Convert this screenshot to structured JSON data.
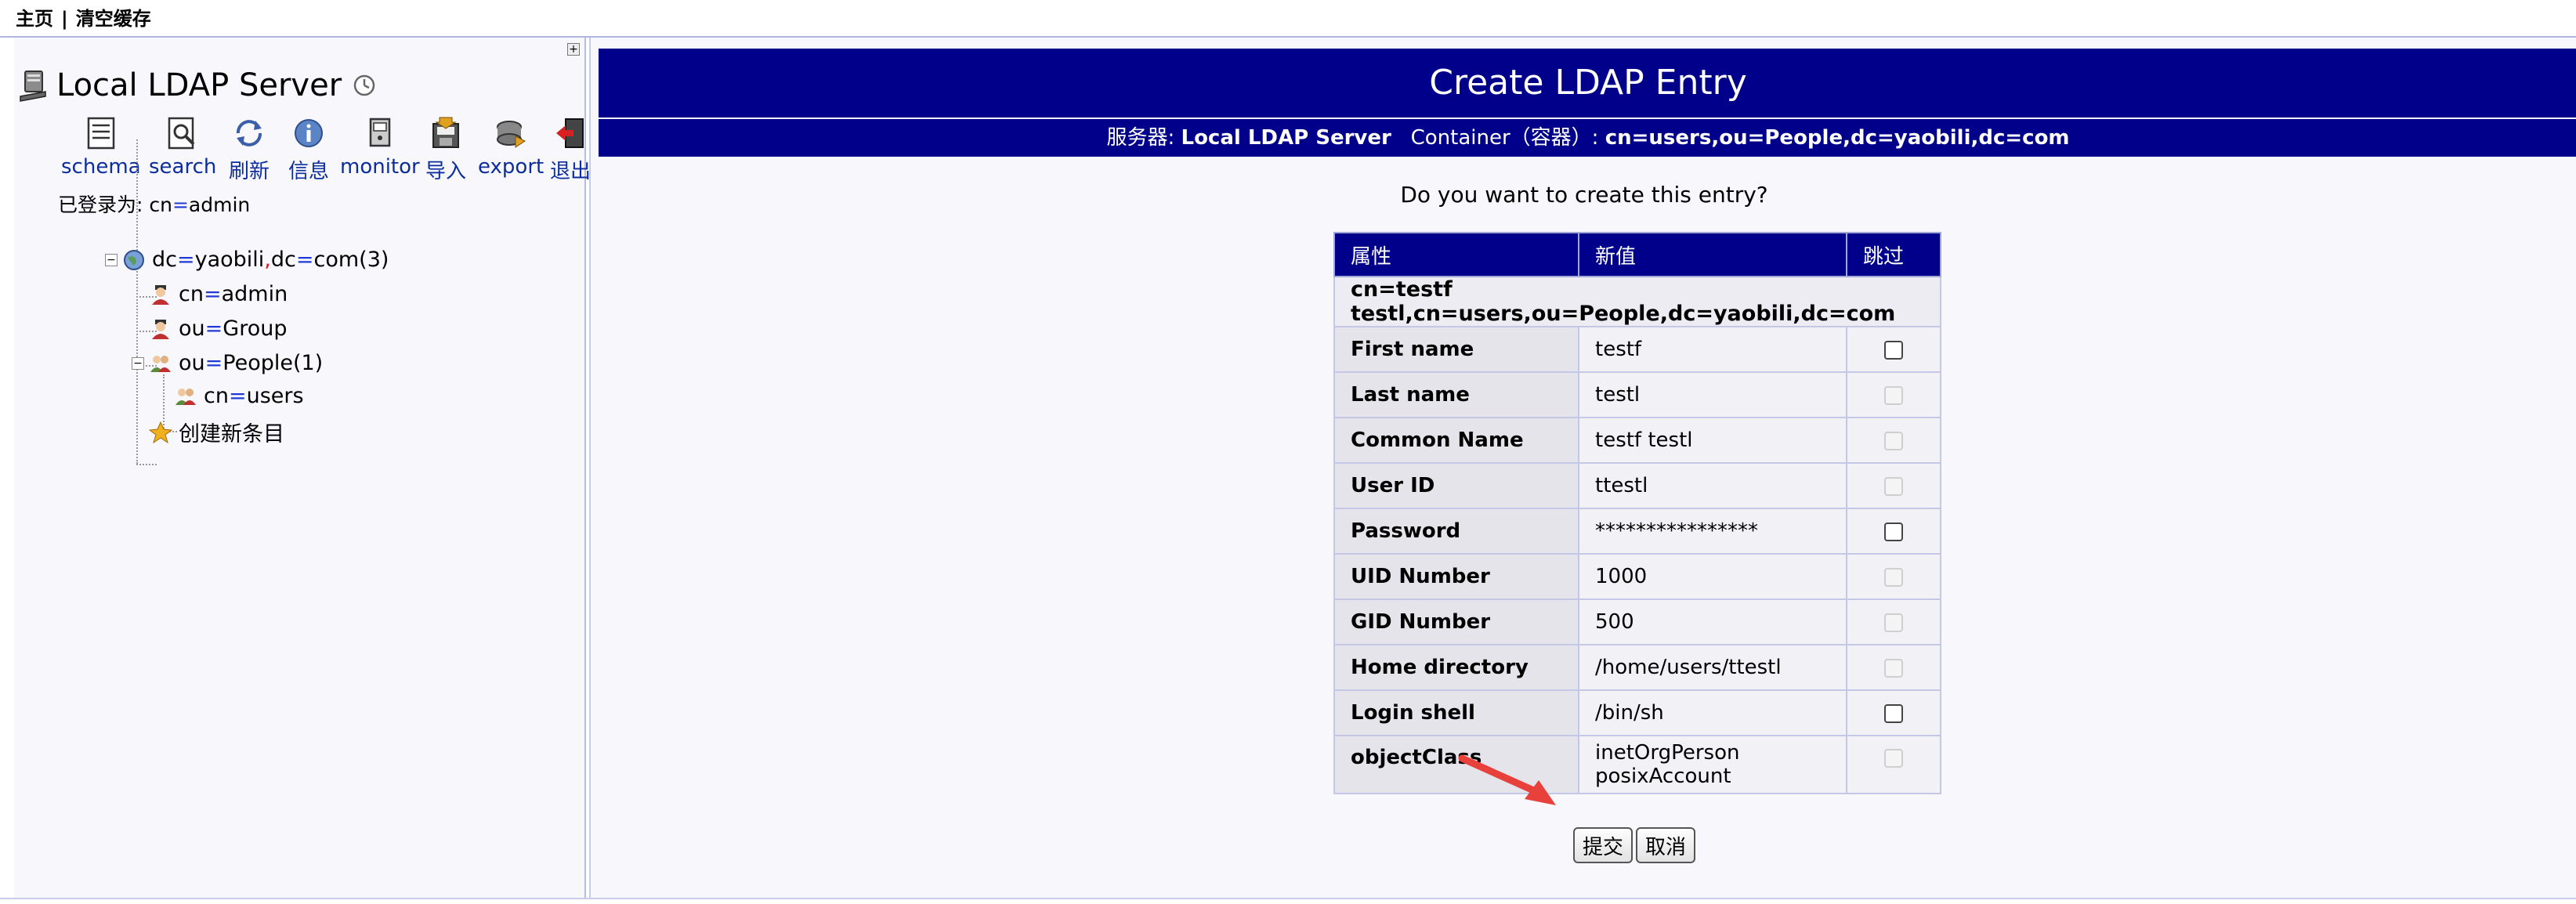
{
  "top_menu": {
    "home": "主页",
    "separator": "|",
    "purge_cache": "清空缓存"
  },
  "left_panel": {
    "expand_symbol": "+",
    "server_name": "Local LDAP Server",
    "toolbar": [
      {
        "name": "schema",
        "label": "schema",
        "icon": "schema-icon"
      },
      {
        "name": "search",
        "label": "search",
        "icon": "search-icon"
      },
      {
        "name": "refresh",
        "label": "刷新",
        "icon": "refresh-icon"
      },
      {
        "name": "info",
        "label": "信息",
        "icon": "info-icon"
      },
      {
        "name": "monitor",
        "label": "monitor",
        "icon": "monitor-icon"
      },
      {
        "name": "import",
        "label": "导入",
        "icon": "import-icon"
      },
      {
        "name": "export",
        "label": "export",
        "icon": "export-icon"
      },
      {
        "name": "logout",
        "label": "退出",
        "icon": "logout-icon"
      }
    ],
    "logged_in_prefix": "已登录为: ",
    "logged_in_attr": "cn",
    "logged_in_eq": "=",
    "logged_in_value": "admin",
    "tree": {
      "root": {
        "a1": "dc",
        "v1": "yaobili",
        "comma": ",",
        "a2": "dc",
        "v2": "com",
        "count": " (3)"
      },
      "admin": {
        "attr": "cn",
        "value": "admin"
      },
      "group": {
        "attr": "ou",
        "value": "Group"
      },
      "people": {
        "attr": "ou",
        "value": "People",
        "count": " (1)"
      },
      "users": {
        "attr": "cn",
        "value": "users"
      },
      "create": "创建新条目",
      "eq": "=",
      "collapse": "−"
    }
  },
  "main": {
    "title": "Create LDAP Entry",
    "server_label": "服务器: ",
    "server_value": "Local LDAP Server",
    "container_label": "Container（容器）: ",
    "container_value": "cn=users,ou=People,dc=yaobili,dc=com",
    "question": "Do you want to create this entry?",
    "table": {
      "headers": [
        "属性",
        "新值",
        "跳过"
      ],
      "dn": "cn=testf testl,cn=users,ou=People,dc=yaobili,dc=com",
      "rows": [
        {
          "attr": "First name",
          "value": "testf",
          "skip_enabled": true
        },
        {
          "attr": "Last name",
          "value": "testl",
          "skip_enabled": false
        },
        {
          "attr": "Common Name",
          "value": "testf testl",
          "skip_enabled": false
        },
        {
          "attr": "User ID",
          "value": "ttestl",
          "skip_enabled": false
        },
        {
          "attr": "Password",
          "value": "****************",
          "skip_enabled": true
        },
        {
          "attr": "UID Number",
          "value": "1000",
          "skip_enabled": false
        },
        {
          "attr": "GID Number",
          "value": "500",
          "skip_enabled": false
        },
        {
          "attr": "Home directory",
          "value": "/home/users/ttestl",
          "skip_enabled": false
        },
        {
          "attr": "Login shell",
          "value": "/bin/sh",
          "skip_enabled": true
        },
        {
          "attr": "objectClass",
          "value": "inetOrgPerson",
          "value2": "posixAccount",
          "skip_enabled": false
        }
      ]
    },
    "submit_label": "提交",
    "cancel_label": "取消"
  },
  "colors": {
    "header_bg": "#00008b",
    "link": "#0b2d9e",
    "annotation_arrow": "#e8403a"
  }
}
